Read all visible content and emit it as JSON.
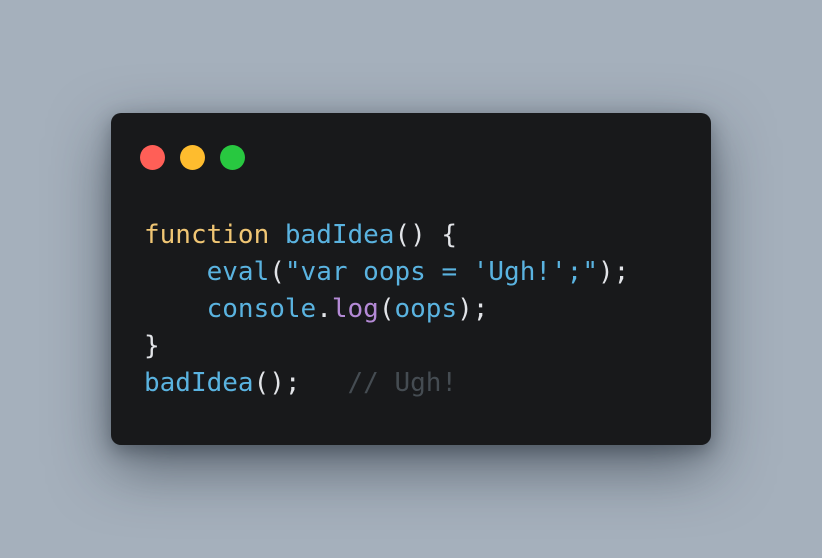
{
  "window": {
    "controls": {
      "close": {
        "icon": "close-dot-icon",
        "color": "#ff5f57"
      },
      "minimize": {
        "icon": "minimize-dot-icon",
        "color": "#febc2e"
      },
      "maximize": {
        "icon": "maximize-dot-icon",
        "color": "#28c840"
      }
    },
    "background": "#18191b"
  },
  "page": {
    "background": "#a5b0bc"
  },
  "code": {
    "lines": [
      {
        "tokens": [
          {
            "text": "function",
            "type": "keyword"
          },
          {
            "text": " ",
            "type": "plain"
          },
          {
            "text": "badIdea",
            "type": "function"
          },
          {
            "text": "() {",
            "type": "punct"
          }
        ]
      },
      {
        "tokens": [
          {
            "text": "    ",
            "type": "plain"
          },
          {
            "text": "eval",
            "type": "function"
          },
          {
            "text": "(",
            "type": "punct"
          },
          {
            "text": "\"var oops = 'Ugh!';\"",
            "type": "string"
          },
          {
            "text": ");",
            "type": "punct"
          }
        ]
      },
      {
        "tokens": [
          {
            "text": "    ",
            "type": "plain"
          },
          {
            "text": "console",
            "type": "function"
          },
          {
            "text": ".",
            "type": "punct"
          },
          {
            "text": "log",
            "type": "property"
          },
          {
            "text": "(",
            "type": "punct"
          },
          {
            "text": "oops",
            "type": "function"
          },
          {
            "text": ");",
            "type": "punct"
          }
        ]
      },
      {
        "tokens": [
          {
            "text": "}",
            "type": "punct"
          }
        ]
      },
      {
        "tokens": [
          {
            "text": "badIdea",
            "type": "function"
          },
          {
            "text": "();",
            "type": "punct"
          },
          {
            "text": "   ",
            "type": "plain"
          },
          {
            "text": "// Ugh!",
            "type": "comment"
          }
        ]
      }
    ]
  },
  "syntax_colors": {
    "keyword": "#f0c674",
    "function": "#5ab3e0",
    "string": "#5ab3e0",
    "property": "#b48ad6",
    "punct": "#e2e4e8",
    "comment": "#454c52"
  }
}
